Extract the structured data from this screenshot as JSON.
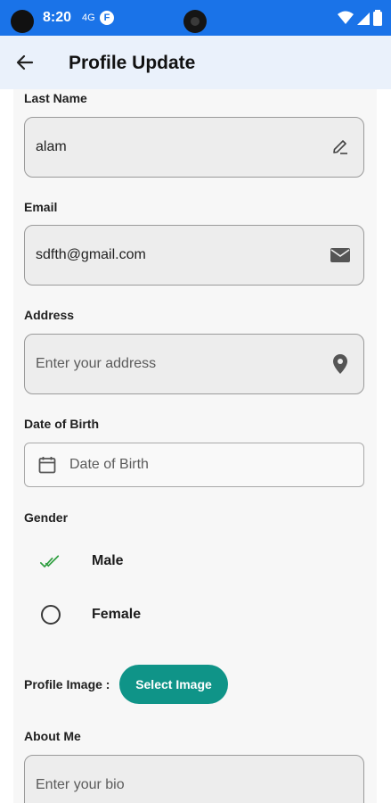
{
  "status_bar": {
    "time": "8:20",
    "mini_icons": [
      "4G",
      "F"
    ]
  },
  "app_bar": {
    "title": "Profile Update"
  },
  "form": {
    "last_name": {
      "label": "Last Name",
      "value": "alam",
      "icon": "edit-icon"
    },
    "email": {
      "label": "Email",
      "value": "sdfth@gmail.com",
      "icon": "mail-icon"
    },
    "address": {
      "label": "Address",
      "placeholder": "Enter your address",
      "icon": "location-pin-icon"
    },
    "dob": {
      "label": "Date of Birth",
      "placeholder": "Date of Birth",
      "icon": "calendar-icon"
    },
    "gender": {
      "label": "Gender",
      "options": [
        {
          "label": "Male",
          "selected": true
        },
        {
          "label": "Female",
          "selected": false
        }
      ]
    },
    "profile_image": {
      "label": "Profile Image :",
      "button": "Select Image"
    },
    "about": {
      "label": "About Me",
      "placeholder": "Enter your bio"
    }
  },
  "colors": {
    "status_bar": "#1a73e8",
    "app_bar": "#eaf1fb",
    "accent": "#0f9488",
    "check": "#2e9e3f"
  }
}
